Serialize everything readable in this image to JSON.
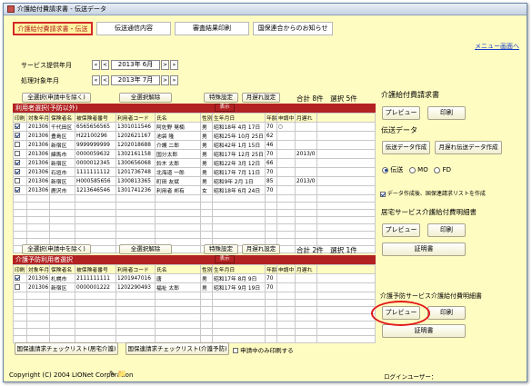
{
  "window": {
    "title": "介護給付費請求書 - 伝送データ"
  },
  "tabs": [
    {
      "label": "介護給付費請求書・伝送",
      "active": true
    },
    {
      "label": "伝送通信内容",
      "active": false
    },
    {
      "label": "審査結果印刷",
      "active": false
    },
    {
      "label": "国保連合からのお知らせ",
      "active": false
    }
  ],
  "menu_link": "メニュー画面へ",
  "service_year_label": "サービス提供年月",
  "service_year_value": "2013年 6月",
  "process_month_label": "処理対象年月",
  "process_month_value": "2013年 7月",
  "nav": {
    "first": "«",
    "prev": "<",
    "next": ">",
    "last": "»"
  },
  "section1": {
    "select_all": "全選択(申請中を除く)",
    "deselect_all": "全選択解除",
    "special": "特殊設定",
    "late": "月遅れ設定",
    "total": "合計 8件　選択 5件",
    "header": "利用者選択(予防以外)",
    "display_btn": "表示",
    "columns": [
      "印刷",
      "対象年月",
      "保険者名",
      "被保険者番号",
      "利用者コード",
      "氏名",
      "性別",
      "生年月日",
      "年齢",
      "申請中",
      "月遅れ"
    ],
    "rows": [
      {
        "check": true,
        "ym": "201306",
        "ins": "千代田区",
        "num": "6565656565",
        "code": "1301011546",
        "name": "阿佐野 晃楠",
        "sex": "男",
        "birth": "昭和18年 4月 17日",
        "age": "70",
        "apply": "○",
        "late": ""
      },
      {
        "check": true,
        "ym": "201306",
        "ins": "豊島区",
        "num": "H22100296",
        "code": "1202621167",
        "name": "池袋 隆",
        "sex": "男",
        "birth": "昭和25年 10月 25日",
        "age": "62",
        "apply": "",
        "late": ""
      },
      {
        "check": false,
        "ym": "201306",
        "ins": "新宿区",
        "num": "9999999999",
        "code": "1202018688",
        "name": "介護 二郎",
        "sex": "男",
        "birth": "昭和42年 1月 15日",
        "age": "46",
        "apply": "",
        "late": ""
      },
      {
        "check": false,
        "ym": "201306",
        "ins": "練馬市",
        "num": "0000059632",
        "code": "1302161158",
        "name": "国分太郎",
        "sex": "男",
        "birth": "昭和17年 12月 25日",
        "age": "70",
        "apply": "",
        "late": "2013/0"
      },
      {
        "check": true,
        "ym": "201306",
        "ins": "新宿区",
        "num": "0000012345",
        "code": "1300656068",
        "name": "鈴木 太郎",
        "sex": "男",
        "birth": "昭和22年 3月 12日",
        "age": "66",
        "apply": "",
        "late": ""
      },
      {
        "check": true,
        "ym": "201306",
        "ins": "石垣市",
        "num": "1111111112",
        "code": "1201736748",
        "name": "北海道 一郎",
        "sex": "男",
        "birth": "昭和17年 7月 11日",
        "age": "70",
        "apply": "",
        "late": ""
      },
      {
        "check": false,
        "ym": "201306",
        "ins": "新宿区",
        "num": "H000585656",
        "code": "1300813365",
        "name": "町田 友斌",
        "sex": "男",
        "birth": "昭和9年 2月 1日",
        "age": "85",
        "apply": "",
        "late": "2013/0"
      },
      {
        "check": true,
        "ym": "201306",
        "ins": "鹿沢市",
        "num": "1213646546",
        "code": "1301741236",
        "name": "利用者 邦有",
        "sex": "女",
        "birth": "昭和18年 6月 24日",
        "age": "70",
        "apply": "",
        "late": ""
      }
    ]
  },
  "section2": {
    "select_all": "全選択(申請中を除く)",
    "deselect_all": "全選択解除",
    "special": "特殊設定",
    "late": "月遅れ設定",
    "total": "合計 2件　選択 1件",
    "header": "介護予防利用者選択",
    "display_btn": "表示",
    "rows": [
      {
        "check": true,
        "ym": "201306",
        "ins": "札幌市",
        "num": "2111111111",
        "code": "1201947016",
        "name": "唐",
        "sex": "男",
        "birth": "昭和17年 8月 9日",
        "age": "70",
        "apply": "",
        "late": ""
      },
      {
        "check": false,
        "ym": "201306",
        "ins": "新宿区",
        "num": "0000001222",
        "code": "1202290493",
        "name": "福祉 太郎",
        "sex": "男",
        "birth": "昭和17年 9月 19日",
        "age": "70",
        "apply": "",
        "late": ""
      }
    ]
  },
  "bottom": {
    "check_care": "国保連請求チェックリスト(居宅介護)",
    "check_prev": "国保連請求チェックリスト(介護予防)",
    "only_applying": "申請中のみ印刷する"
  },
  "right": {
    "claim_title": "介護給付費請求書",
    "preview": "プレビュー",
    "print": "印刷",
    "transmit_title": "伝送データ",
    "make_data": "伝送データ作成",
    "late_data": "月遅れ伝送データ作成",
    "radio_options": [
      "伝送",
      "MO",
      "FD"
    ],
    "list_check": "データ作成後、国保連請求リストを作成",
    "home_title": "居宅サービス介護給付費明細書",
    "certificate": "証明書",
    "prevent_title": "介護予防サービス介護給付費明細書"
  },
  "status": {
    "copyright": "Copyright (C) 2004 LIONet Corporation",
    "login": "ログインユーザー："
  }
}
